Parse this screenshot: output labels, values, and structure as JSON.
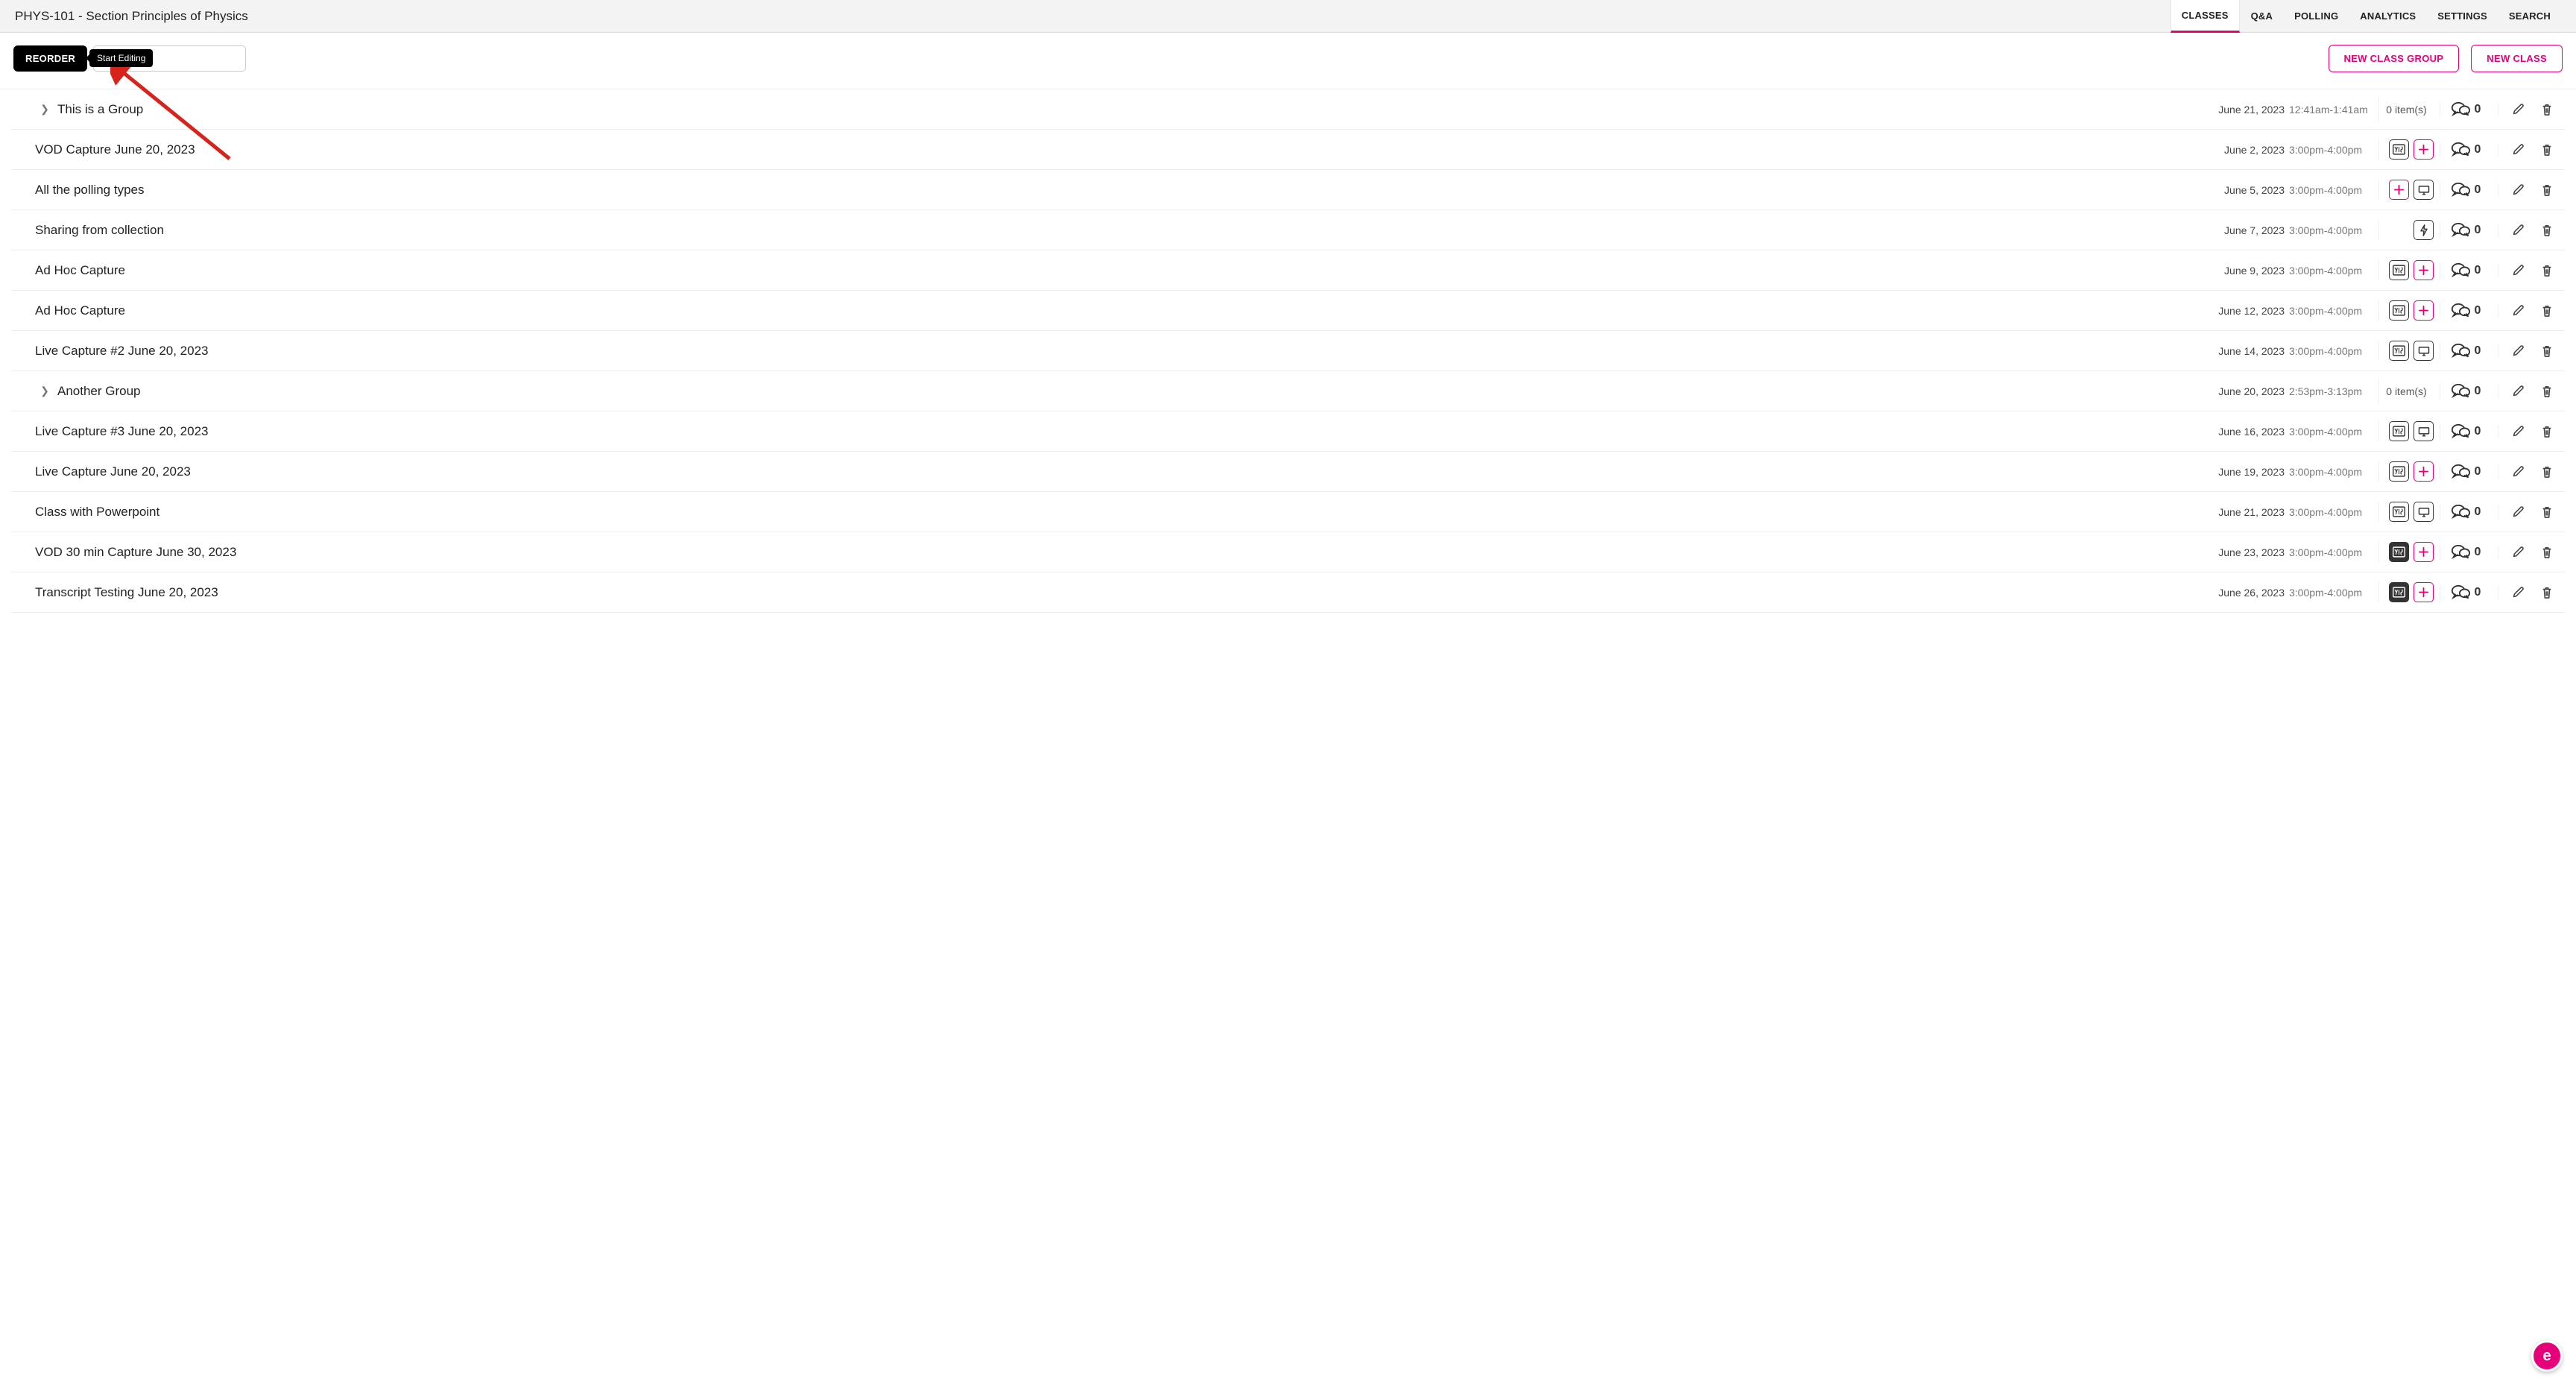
{
  "header": {
    "title": "PHYS-101 - Section Principles of Physics",
    "tabs": [
      "CLASSES",
      "Q&A",
      "POLLING",
      "ANALYTICS",
      "SETTINGS",
      "SEARCH"
    ],
    "active_tab": 0
  },
  "toolbar": {
    "reorder_label": "REORDER",
    "tooltip": "Start Editing",
    "search_placeholder": "",
    "new_group_label": "NEW CLASS GROUP",
    "new_class_label": "NEW CLASS"
  },
  "rows": [
    {
      "type": "group",
      "title": "This is a Group",
      "date": "June 21, 2023",
      "time": "12:41am-1:41am",
      "items_text": "0 item(s)",
      "comments": "0"
    },
    {
      "type": "class",
      "title": "VOD Capture June 20, 2023",
      "date": "June 2, 2023",
      "time": "3:00pm-4:00pm",
      "icons": [
        "media",
        "plus_pink"
      ],
      "comments": "0"
    },
    {
      "type": "class",
      "title": "All the polling types",
      "date": "June 5, 2023",
      "time": "3:00pm-4:00pm",
      "icons": [
        "plus_pink",
        "screen"
      ],
      "comments": "0"
    },
    {
      "type": "class",
      "title": "Sharing from collection",
      "date": "June 7, 2023",
      "time": "3:00pm-4:00pm",
      "icons": [
        "bolt"
      ],
      "comments": "0"
    },
    {
      "type": "class",
      "title": "Ad Hoc Capture",
      "date": "June 9, 2023",
      "time": "3:00pm-4:00pm",
      "icons": [
        "media",
        "plus_pink"
      ],
      "comments": "0"
    },
    {
      "type": "class",
      "title": "Ad Hoc Capture",
      "date": "June 12, 2023",
      "time": "3:00pm-4:00pm",
      "icons": [
        "media",
        "plus_pink"
      ],
      "comments": "0"
    },
    {
      "type": "class",
      "title": "Live Capture #2 June 20, 2023",
      "date": "June 14, 2023",
      "time": "3:00pm-4:00pm",
      "icons": [
        "media",
        "screen"
      ],
      "comments": "0"
    },
    {
      "type": "group",
      "title": "Another Group",
      "date": "June 20, 2023",
      "time": "2:53pm-3:13pm",
      "items_text": "0 item(s)",
      "comments": "0"
    },
    {
      "type": "class",
      "title": "Live Capture #3 June 20, 2023",
      "date": "June 16, 2023",
      "time": "3:00pm-4:00pm",
      "icons": [
        "media",
        "screen"
      ],
      "comments": "0"
    },
    {
      "type": "class",
      "title": "Live Capture June 20, 2023",
      "date": "June 19, 2023",
      "time": "3:00pm-4:00pm",
      "icons": [
        "media",
        "plus_pink"
      ],
      "comments": "0"
    },
    {
      "type": "class",
      "title": "Class with Powerpoint",
      "date": "June 21, 2023",
      "time": "3:00pm-4:00pm",
      "icons": [
        "media",
        "screen"
      ],
      "comments": "0"
    },
    {
      "type": "class",
      "title": "VOD 30 min Capture June 30, 2023",
      "date": "June 23, 2023",
      "time": "3:00pm-4:00pm",
      "icons": [
        "media_dark",
        "plus_pink"
      ],
      "comments": "0"
    },
    {
      "type": "class",
      "title": "Transcript Testing June 20, 2023",
      "date": "June 26, 2023",
      "time": "3:00pm-4:00pm",
      "icons": [
        "media_dark",
        "plus_pink"
      ],
      "comments": "0"
    }
  ],
  "float_badge": "e"
}
